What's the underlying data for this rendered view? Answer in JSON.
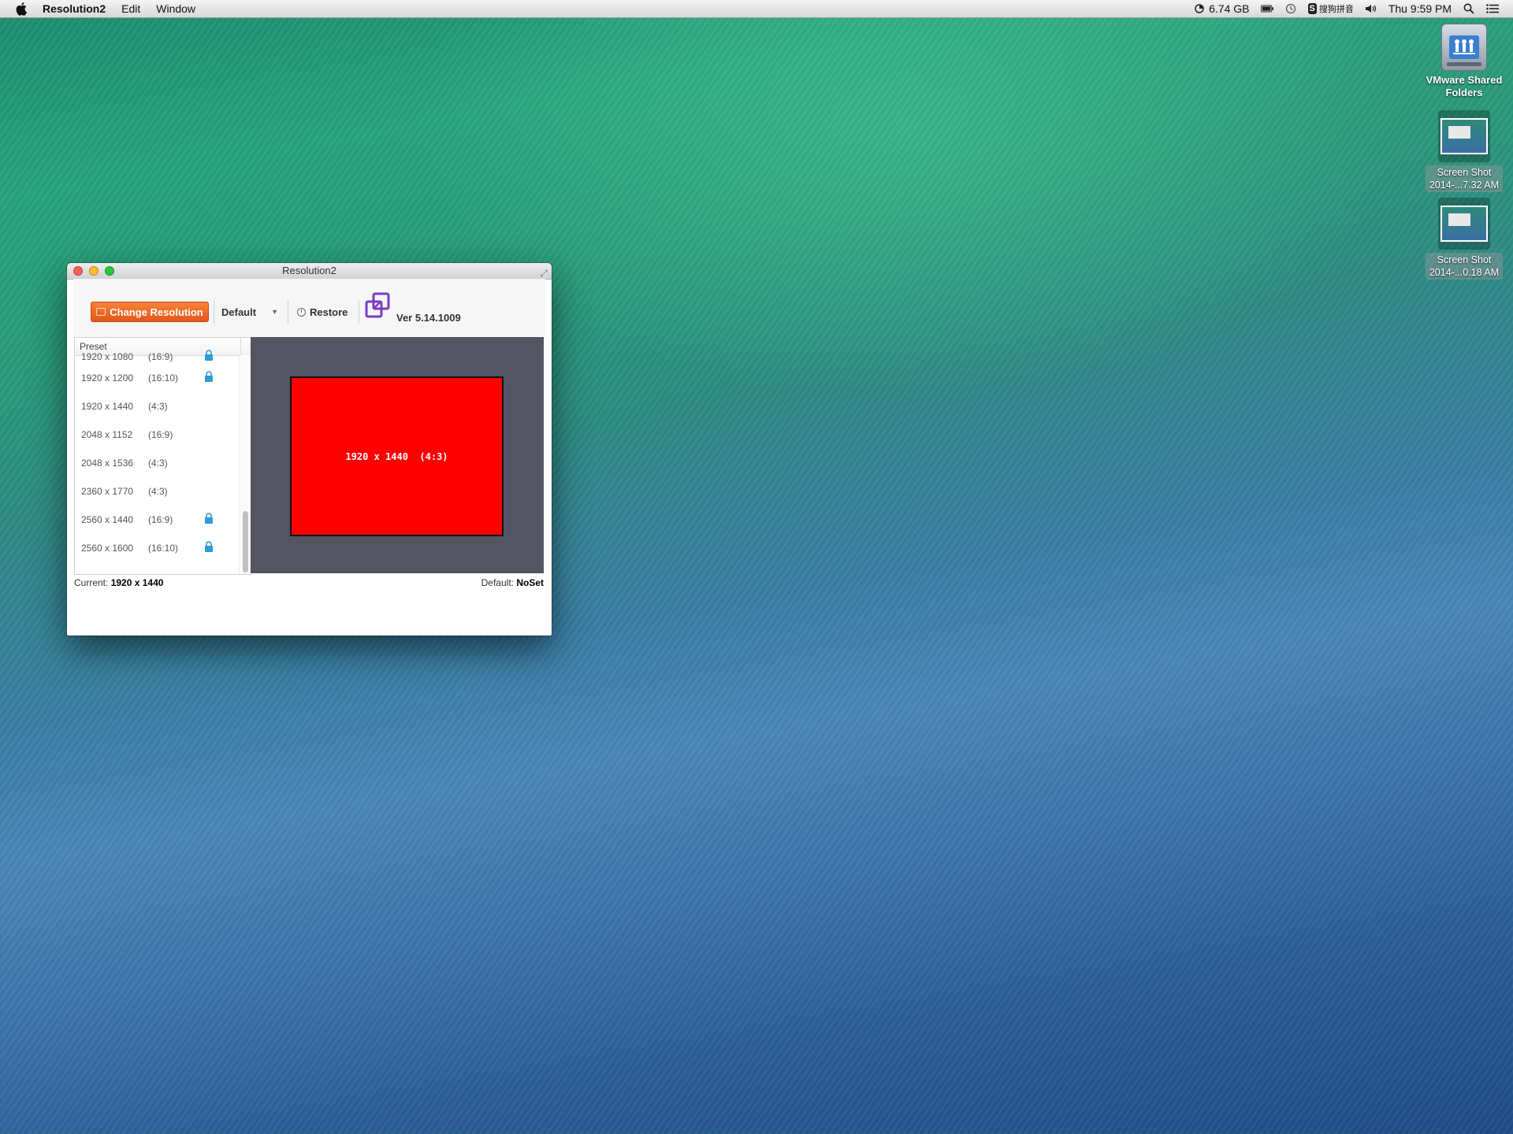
{
  "menubar": {
    "app_name": "Resolution2",
    "menus": [
      "Edit",
      "Window"
    ],
    "memory": "6.74 GB",
    "ime_badge": "S",
    "ime_text": "搜狗拼音",
    "clock": "Thu 9:59 PM",
    "icons": [
      "apple-icon",
      "memory-icon",
      "battery-icon",
      "time-machine-icon",
      "sogou-ime-icon",
      "volume-icon",
      "spotlight-icon",
      "notification-center-icon"
    ]
  },
  "desktop": {
    "icons": [
      {
        "label": "VMware Shared Folders",
        "kind": "drive"
      },
      {
        "label_line1": "Screen Shot",
        "label_line2": "2014-...7.32 AM",
        "kind": "screenshot"
      },
      {
        "label_line1": "Screen Shot",
        "label_line2": "2014-...0.18 AM",
        "kind": "screenshot"
      }
    ]
  },
  "window": {
    "title": "Resolution2",
    "toolbar": {
      "change_label": "Change Resolution",
      "dropdown_value": "Default",
      "restore_label": "Restore",
      "version": "Ver 5.14.1009"
    },
    "list": {
      "header": "Preset",
      "rows": [
        {
          "res": "1920 x 1080",
          "ratio": "(16:9)",
          "locked": true
        },
        {
          "res": "1920 x 1200",
          "ratio": "(16:10)",
          "locked": true
        },
        {
          "res": "1920 x 1440",
          "ratio": "(4:3)",
          "locked": false
        },
        {
          "res": "2048 x 1152",
          "ratio": "(16:9)",
          "locked": false
        },
        {
          "res": "2048 x 1536",
          "ratio": "(4:3)",
          "locked": false
        },
        {
          "res": "2360 x 1770",
          "ratio": "(4:3)",
          "locked": false
        },
        {
          "res": "2560 x 1440",
          "ratio": "(16:9)",
          "locked": true
        },
        {
          "res": "2560 x 1600",
          "ratio": "(16:10)",
          "locked": true
        }
      ]
    },
    "preview": {
      "label": "1920 x 1440  (4:3)"
    },
    "status": {
      "current_label": "Current:",
      "current_value": "1920 x 1440",
      "default_label": "Default:",
      "default_value": "NoSet"
    }
  },
  "colors": {
    "accent": "#f0692a",
    "preview_bg": "#545463",
    "preview_screen": "#ff0000",
    "lock": "#2e9bd6"
  }
}
